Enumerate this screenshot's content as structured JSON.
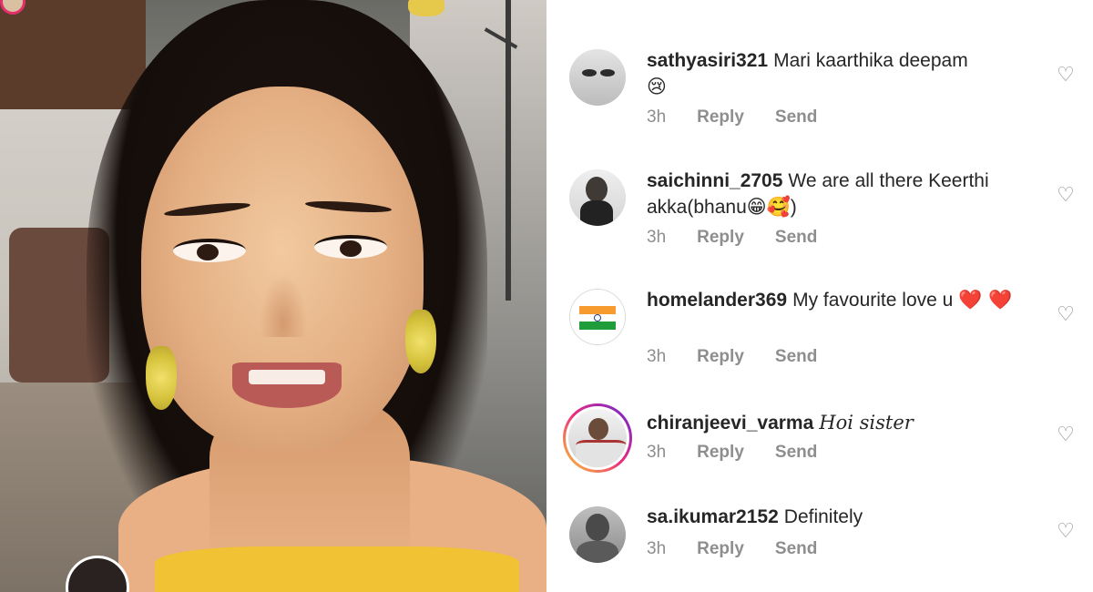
{
  "comments": [
    {
      "username": "sathyasiri321",
      "text": "Mari kaarthika deepam",
      "text_emoji": "😢",
      "time": "3h",
      "reply_label": "Reply",
      "send_label": "Send",
      "like_icon": "♡"
    },
    {
      "username": "saichinni_2705",
      "text": "We are all there Keerthi akka(bhanu",
      "text_emoji": "😁🥰",
      "text_end": ")",
      "time": "3h",
      "reply_label": "Reply",
      "send_label": "Send",
      "like_icon": "♡"
    },
    {
      "username": "homelander369",
      "text": "My favourite love u",
      "text_emoji": "❤️ ❤️",
      "time": "3h",
      "reply_label": "Reply",
      "send_label": "Send",
      "like_icon": "♡"
    },
    {
      "username": "chiranjeevi_varma",
      "text": "𝐻𝑜𝑖 𝑠𝑖𝑠𝑡𝑒𝑟",
      "time": "3h",
      "reply_label": "Reply",
      "send_label": "Send",
      "like_icon": "♡"
    },
    {
      "username": "sa.ikumar2152",
      "text": "Definitely",
      "time": "3h",
      "reply_label": "Reply",
      "send_label": "Send",
      "like_icon": "♡"
    }
  ],
  "colors": {
    "text": "#262626",
    "meta": "#8e8e8e",
    "heart_emoji": "#e0245e",
    "story_ring": "#ee2a7b",
    "dress": "#f0c234"
  }
}
